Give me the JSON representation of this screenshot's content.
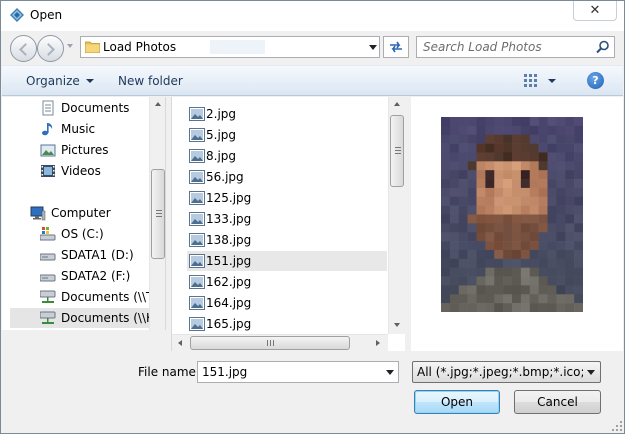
{
  "window": {
    "title": "Open",
    "close_glyph": "✕"
  },
  "address": {
    "path": "Load Photos",
    "icon": "folder-icon"
  },
  "search": {
    "placeholder": "Search Load Photos",
    "icon": "search-icon"
  },
  "toolbar": {
    "organize_label": "Organize",
    "new_folder_label": "New folder",
    "help_glyph": "?"
  },
  "nav_pane": {
    "items": [
      {
        "label": "Documents",
        "icon": "documents-icon"
      },
      {
        "label": "Music",
        "icon": "music-icon"
      },
      {
        "label": "Pictures",
        "icon": "pictures-icon"
      },
      {
        "label": "Videos",
        "icon": "videos-icon"
      },
      {
        "label": "Computer",
        "icon": "computer-icon"
      },
      {
        "label": "OS (C:)",
        "icon": "system-drive-icon"
      },
      {
        "label": "SDATA1 (D:)",
        "icon": "drive-icon"
      },
      {
        "label": "SDATA2 (F:)",
        "icon": "drive-icon"
      },
      {
        "label": "Documents (\\\\TV",
        "icon": "network-drive-icon"
      },
      {
        "label": "Documents (\\\\KD",
        "icon": "network-drive-icon",
        "selected": true
      }
    ]
  },
  "files": {
    "items": [
      {
        "name": "2.jpg"
      },
      {
        "name": "5.jpg"
      },
      {
        "name": "8.jpg"
      },
      {
        "name": "56.jpg"
      },
      {
        "name": "125.jpg"
      },
      {
        "name": "133.jpg"
      },
      {
        "name": "138.jpg"
      },
      {
        "name": "151.jpg",
        "selected": true
      },
      {
        "name": "162.jpg"
      },
      {
        "name": "164.jpg"
      },
      {
        "name": "165.jpg"
      }
    ]
  },
  "bottom": {
    "file_name_label": "File name:",
    "file_name_value": "151.jpg",
    "file_type_value": "All (*.jpg;*.jpeg;*.bmp;*.ico;*.er",
    "open_label": "Open",
    "cancel_label": "Cancel"
  },
  "colors": {
    "accent": "#3c7fb1",
    "toolbar_text": "#1e395b",
    "selection": "#e5e5e5"
  }
}
